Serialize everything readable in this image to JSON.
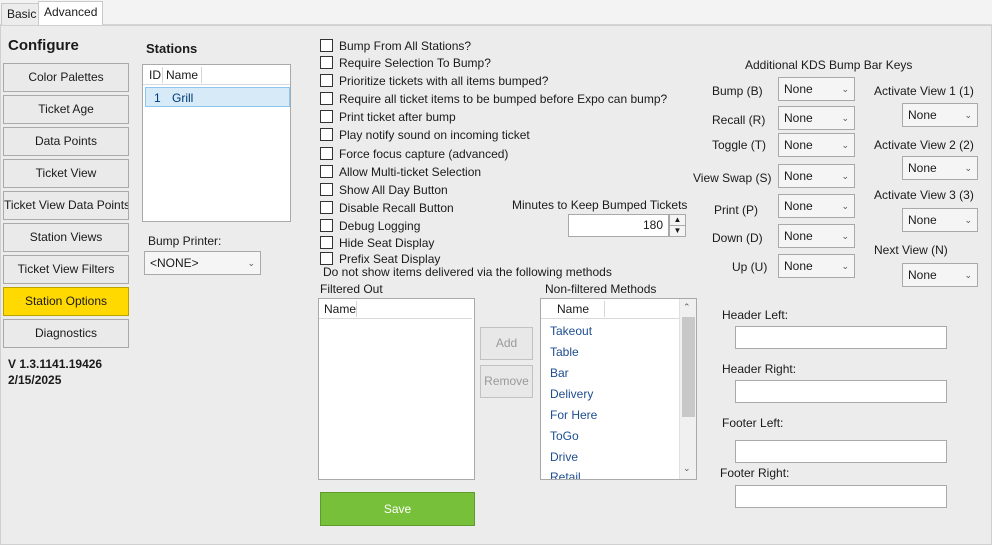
{
  "tabs": [
    "Basic",
    "Advanced"
  ],
  "configure": {
    "title": "Configure",
    "buttons": [
      "Color Palettes",
      "Ticket Age",
      "Data Points",
      "Ticket View",
      "Ticket View Data Points",
      "Station Views",
      "Ticket View Filters",
      "Station Options",
      "Diagnostics"
    ],
    "active": "Station Options",
    "version": "V 1.3.1141.19426",
    "date": "2/15/2025"
  },
  "stations": {
    "title": "Stations",
    "columns": [
      "ID",
      "Name"
    ],
    "rows": [
      {
        "id": "1",
        "name": "Grill"
      }
    ],
    "bump_printer_label": "Bump Printer:",
    "bump_printer_value": "<NONE>"
  },
  "options": {
    "checkboxes": [
      {
        "label": "Bump From All Stations?",
        "checked": false
      },
      {
        "label": "Require Selection To Bump?",
        "checked": false
      },
      {
        "label": "Prioritize tickets with all items bumped?",
        "checked": false
      },
      {
        "label": "Require all ticket items to be bumped before Expo can bump?",
        "checked": false
      },
      {
        "label": "Print ticket after bump",
        "checked": false
      },
      {
        "label": "Play notify sound on incoming ticket",
        "checked": false
      },
      {
        "label": "Force focus capture (advanced)",
        "checked": false
      },
      {
        "label": "Allow Multi-ticket Selection",
        "checked": false
      },
      {
        "label": "Show All Day Button",
        "checked": false
      },
      {
        "label": "Disable Recall Button",
        "checked": false
      },
      {
        "label": "Debug Logging",
        "checked": false
      },
      {
        "label": "Hide Seat Display",
        "checked": false
      },
      {
        "label": "Prefix Seat Display",
        "checked": false
      }
    ],
    "delivery_note": "Do not show items delivered via the following methods",
    "minutes_label": "Minutes to Keep Bumped Tickets",
    "minutes_value": "180"
  },
  "filters": {
    "filtered_out_label": "Filtered Out",
    "filtered_out_header": "Name",
    "non_filtered_label": "Non-filtered Methods",
    "non_filtered_header": "Name",
    "methods": [
      "Takeout",
      "Table",
      "Bar",
      "Delivery",
      "For Here",
      "ToGo",
      "Drive",
      "Retail"
    ],
    "add_label": "Add",
    "remove_label": "Remove"
  },
  "bump_keys": {
    "title": "Additional KDS Bump Bar Keys",
    "left": [
      {
        "label": "Bump (B)",
        "value": "None"
      },
      {
        "label": "Recall (R)",
        "value": "None"
      },
      {
        "label": "Toggle (T)",
        "value": "None"
      },
      {
        "label": "View Swap (S)",
        "value": "None"
      },
      {
        "label": "Print (P)",
        "value": "None"
      },
      {
        "label": "Down (D)",
        "value": "None"
      },
      {
        "label": "Up (U)",
        "value": "None"
      }
    ],
    "right": [
      {
        "label": "Activate View 1 (1)",
        "value": "None"
      },
      {
        "label": "Activate View 2 (2)",
        "value": "None"
      },
      {
        "label": "Activate View 3 (3)",
        "value": "None"
      },
      {
        "label": "Next View (N)",
        "value": "None"
      }
    ]
  },
  "header_footer": {
    "header_left": {
      "label": "Header Left:",
      "value": ""
    },
    "header_right": {
      "label": "Header Right:",
      "value": ""
    },
    "footer_left": {
      "label": "Footer Left:",
      "value": ""
    },
    "footer_right": {
      "label": "Footer Right:",
      "value": ""
    }
  },
  "save_label": "Save",
  "colors": {
    "active_nav": "#ffd900",
    "save": "#77c13a",
    "selection": "#d6eaf8"
  },
  "icons": [
    "chevron-down-icon",
    "spin-up-icon",
    "spin-down-icon",
    "scroll-up-icon",
    "scroll-down-icon"
  ]
}
